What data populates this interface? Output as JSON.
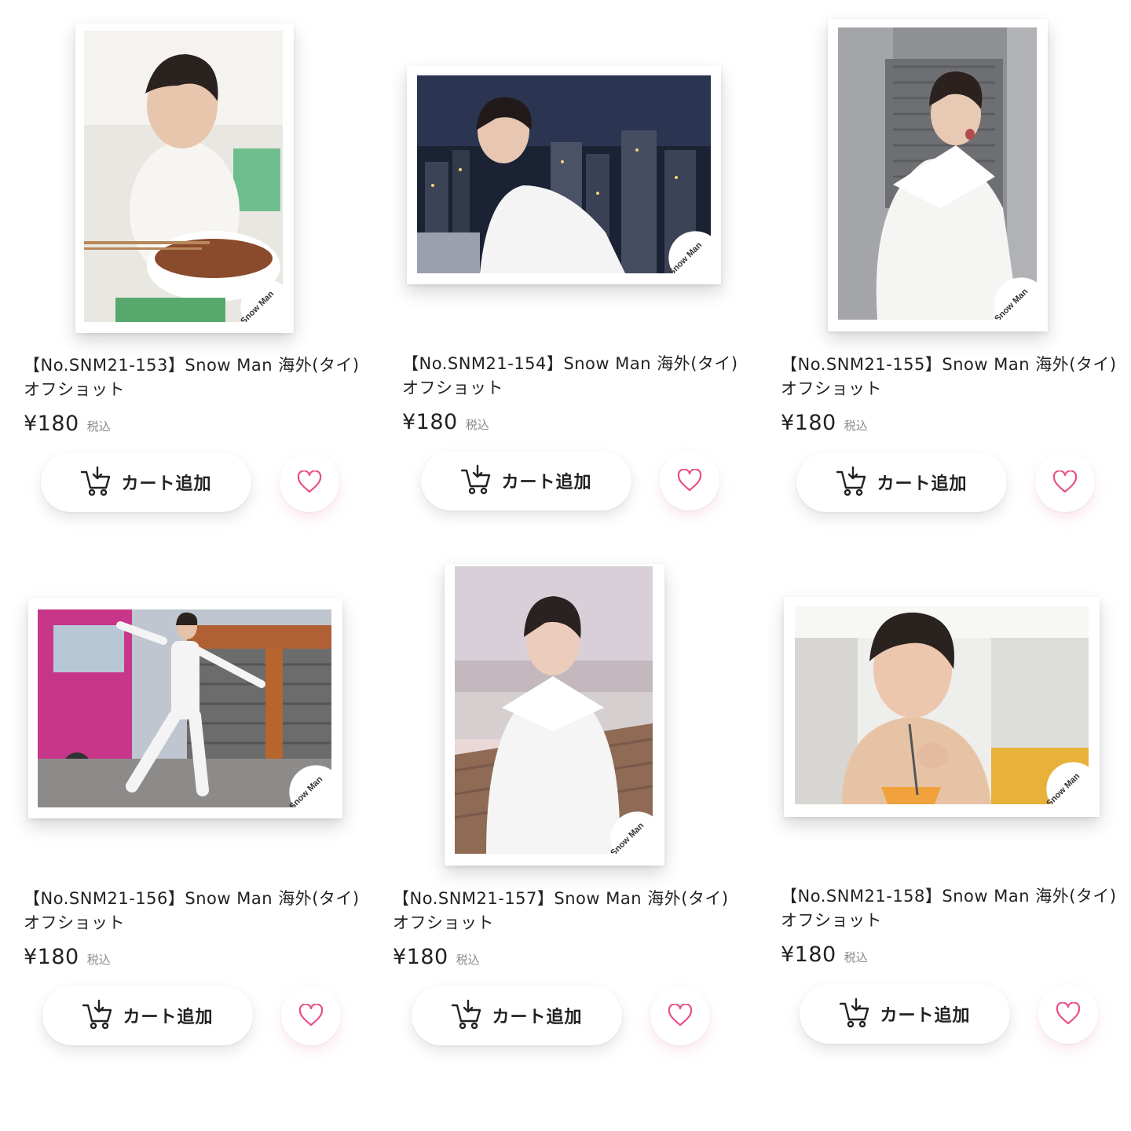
{
  "colors": {
    "accent_pink": "#e84d8a",
    "text": "#222222",
    "muted": "#888888"
  },
  "products": [
    {
      "title": "【No.SNM21-153】Snow Man 海外(タイ)オフショット",
      "price": "¥180",
      "tax_label": "税込",
      "cart_label": "カート追加",
      "stamp": "Snow Man",
      "cart_icon": "cart-icon",
      "fav_icon": "heart-icon"
    },
    {
      "title": "【No.SNM21-154】Snow Man 海外(タイ)オフショット",
      "price": "¥180",
      "tax_label": "税込",
      "cart_label": "カート追加",
      "stamp": "Snow Man",
      "cart_icon": "cart-icon",
      "fav_icon": "heart-icon"
    },
    {
      "title": "【No.SNM21-155】Snow Man 海外(タイ)オフショット",
      "price": "¥180",
      "tax_label": "税込",
      "cart_label": "カート追加",
      "stamp": "Snow Man",
      "cart_icon": "cart-icon",
      "fav_icon": "heart-icon"
    },
    {
      "title": "【No.SNM21-156】Snow Man 海外(タイ)オフショット",
      "price": "¥180",
      "tax_label": "税込",
      "cart_label": "カート追加",
      "stamp": "Snow Man",
      "cart_icon": "cart-icon",
      "fav_icon": "heart-icon"
    },
    {
      "title": "【No.SNM21-157】Snow Man 海外(タイ)オフショット",
      "price": "¥180",
      "tax_label": "税込",
      "cart_label": "カート追加",
      "stamp": "Snow Man",
      "cart_icon": "cart-icon",
      "fav_icon": "heart-icon"
    },
    {
      "title": "【No.SNM21-158】Snow Man 海外(タイ)オフショット",
      "price": "¥180",
      "tax_label": "税込",
      "cart_label": "カート追加",
      "stamp": "Snow Man",
      "cart_icon": "cart-icon",
      "fav_icon": "heart-icon"
    }
  ]
}
